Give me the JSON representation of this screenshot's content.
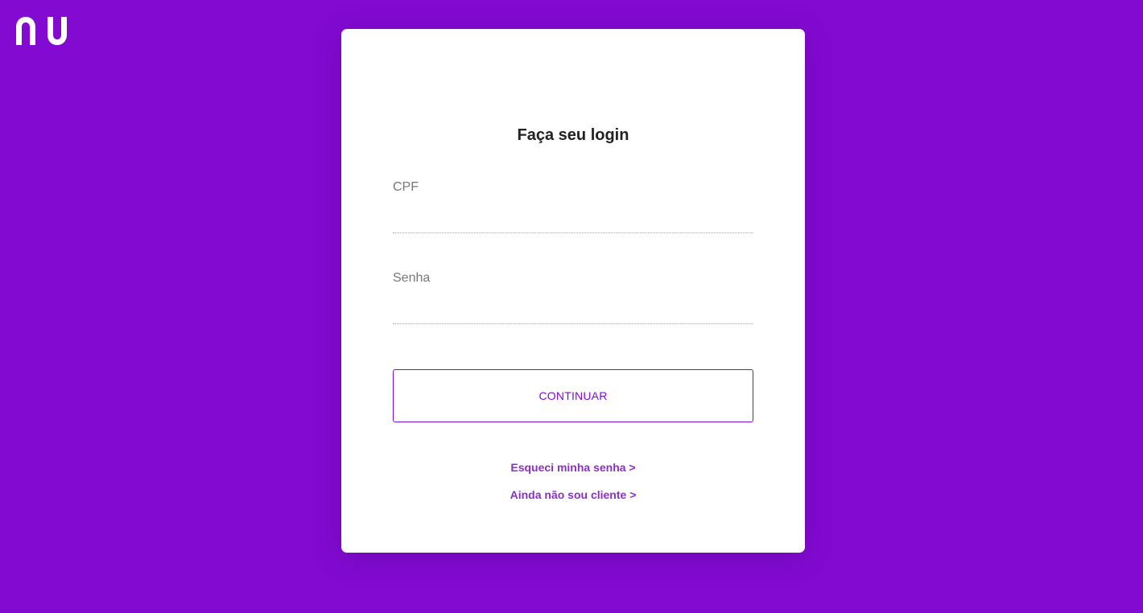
{
  "brand": {
    "logo_text": "nu",
    "logo_icon": "nubank-logo-icon",
    "background_color": "#820ad1"
  },
  "login": {
    "title": "Faça seu login",
    "cpf_label": "CPF",
    "cpf_value": "",
    "password_label": "Senha",
    "password_value": "",
    "continue_label": "CONTINUAR",
    "forgot_password_link": "Esqueci minha senha >",
    "not_client_link": "Ainda não sou cliente >"
  },
  "colors": {
    "accent": "#820ad1",
    "link": "#8a30c6",
    "title": "#222222",
    "label": "#777777"
  }
}
